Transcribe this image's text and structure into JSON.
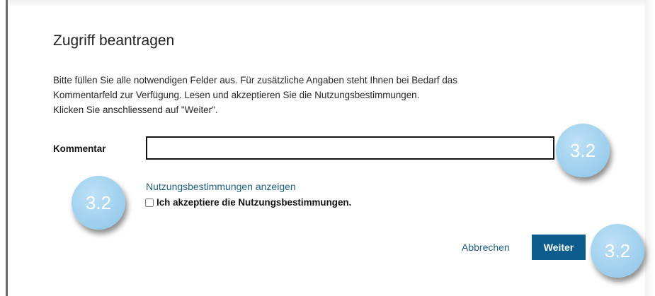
{
  "dialog": {
    "title": "Zugriff beantragen",
    "instructions": [
      "Bitte füllen Sie alle notwendigen Felder aus. Für zusätzliche Angaben steht Ihnen bei Bedarf das",
      "Kommentarfeld zur Verfügung. Lesen und akzeptieren Sie die Nutzungsbestimmungen.",
      "Klicken Sie anschliessend auf \"Weiter\"."
    ]
  },
  "form": {
    "comment_label": "Kommentar",
    "comment_value": "",
    "terms_link": "Nutzungsbestimmungen anzeigen",
    "accept_label": "Ich akzeptiere die Nutzungsbestimmungen.",
    "accept_checked": false
  },
  "actions": {
    "cancel_label": "Abbrechen",
    "next_label": "Weiter"
  },
  "badges": [
    "3.2",
    "3.2",
    "3.2"
  ],
  "colors": {
    "accent": "#0d5c8e",
    "link": "#1b5f86",
    "badge": "#9fd0ee"
  }
}
